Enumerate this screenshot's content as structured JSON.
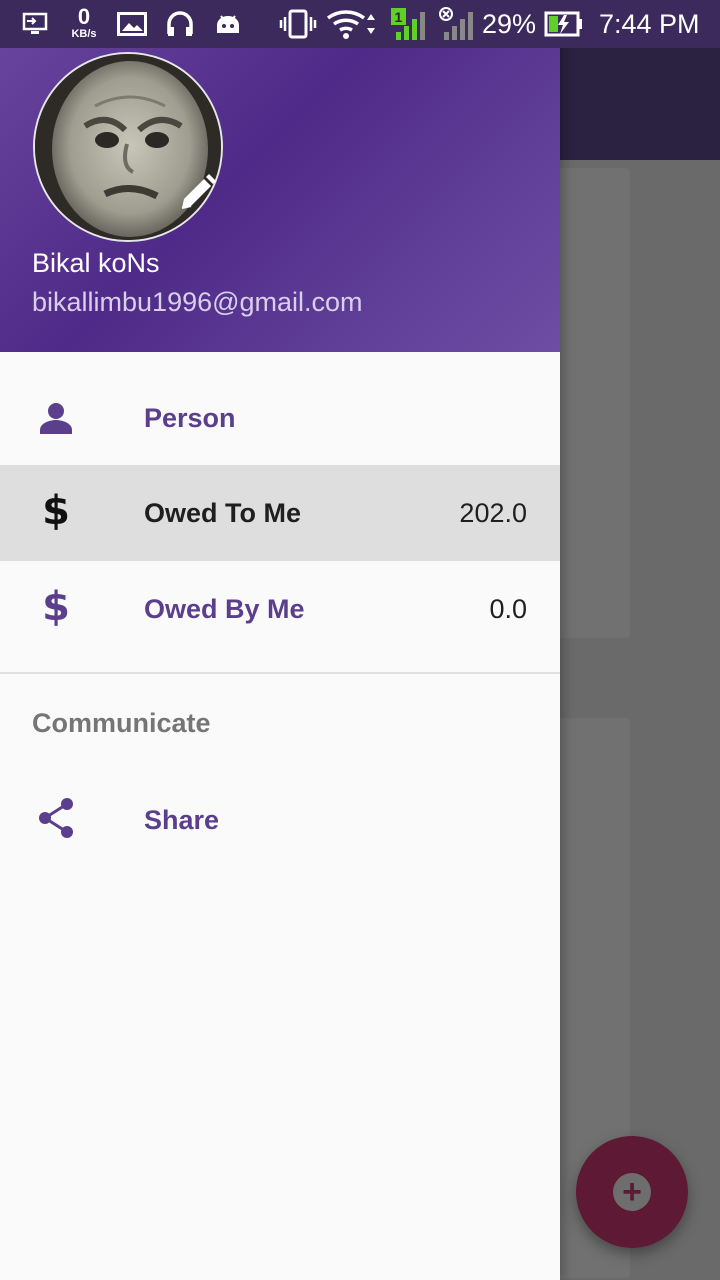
{
  "status_bar": {
    "net_speed_value": "0",
    "net_speed_unit": "KB/s",
    "sim_slot": "1",
    "battery_percent": "29%",
    "time": "7:44 PM"
  },
  "drawer": {
    "header": {
      "user_name": "Bikal koNs",
      "user_email": "bikallimbu1996@gmail.com",
      "edit_icon": "pencil-icon"
    },
    "items": [
      {
        "label": "Person",
        "icon": "person-icon",
        "count": ""
      },
      {
        "label": "Owed To Me",
        "icon": "dollar-icon",
        "count": "202.0",
        "selected": true
      },
      {
        "label": "Owed By Me",
        "icon": "dollar-icon",
        "count": "0.0"
      }
    ],
    "section": {
      "title": "Communicate",
      "items": [
        {
          "label": "Share",
          "icon": "share-icon"
        }
      ]
    },
    "dollar_glyph": "$"
  },
  "fab": {
    "icon": "add-icon",
    "glyph": "+"
  },
  "colors": {
    "accent": "#5b3f8c",
    "header_start": "#6b47a0",
    "header_mid": "#4f2a88",
    "fab": "#5e1a34",
    "selected_row": "#dedede"
  }
}
